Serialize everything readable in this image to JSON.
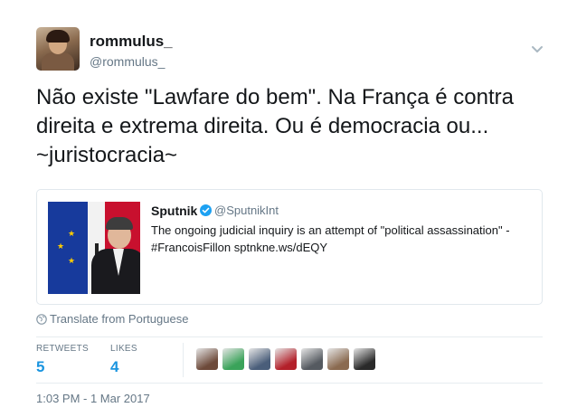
{
  "author": {
    "display_name": "rommulus_",
    "handle": "@rommulus_"
  },
  "tweet": {
    "text": "Não existe \"Lawfare do bem\". Na França é contra direita e extrema direita. Ou é democracia ou... ~juristocracia~"
  },
  "quoted": {
    "name": "Sputnik",
    "handle": "@SputnikInt",
    "text": "The ongoing judicial inquiry is an attempt of \"political assassination\" - #FrancoisFillon sptnkne.ws/dEQY"
  },
  "translate_label": "Translate from Portuguese",
  "stats": {
    "retweets_label": "RETWEETS",
    "retweets_count": "5",
    "likes_label": "LIKES",
    "likes_count": "4"
  },
  "likers": [
    {
      "name": "liker-1",
      "color": "#6d4a3a"
    },
    {
      "name": "liker-2",
      "color": "#3aa35a"
    },
    {
      "name": "liker-3",
      "color": "#4a5e7a"
    },
    {
      "name": "liker-4",
      "color": "#b3202a"
    },
    {
      "name": "liker-5",
      "color": "#555a60"
    },
    {
      "name": "liker-6",
      "color": "#8a6a50"
    },
    {
      "name": "liker-7",
      "color": "#2a2a2a"
    }
  ],
  "timestamp": "1:03 PM - 1 Mar 2017",
  "colors": {
    "link_blue": "#1b95e0",
    "verified_blue": "#1da1f2",
    "muted_gray": "#657786"
  },
  "icons": {
    "more": "chevron-down-icon",
    "verified": "verified-badge-icon",
    "translate": "globe-icon"
  }
}
